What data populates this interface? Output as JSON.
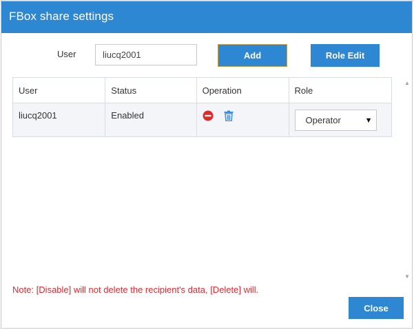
{
  "dialog": {
    "title": "FBox share settings",
    "close_label": "Close",
    "note": "Note: [Disable] will not delete the recipient's data, [Delete] will."
  },
  "form": {
    "user_label": "User",
    "user_value": "liucq2001",
    "add_label": "Add",
    "role_edit_label": "Role Edit"
  },
  "table": {
    "headers": [
      "User",
      "Status",
      "Operation",
      "Role"
    ],
    "rows": [
      {
        "user": "liucq2001",
        "status": "Enabled",
        "operation_icons": [
          "disable-icon",
          "delete-icon"
        ],
        "role": "Operator"
      }
    ]
  },
  "colors": {
    "accent": "#2e87d2",
    "note": "#e0272c",
    "disable_icon": "#e02a2a",
    "delete_icon": "#3a8ee0"
  }
}
